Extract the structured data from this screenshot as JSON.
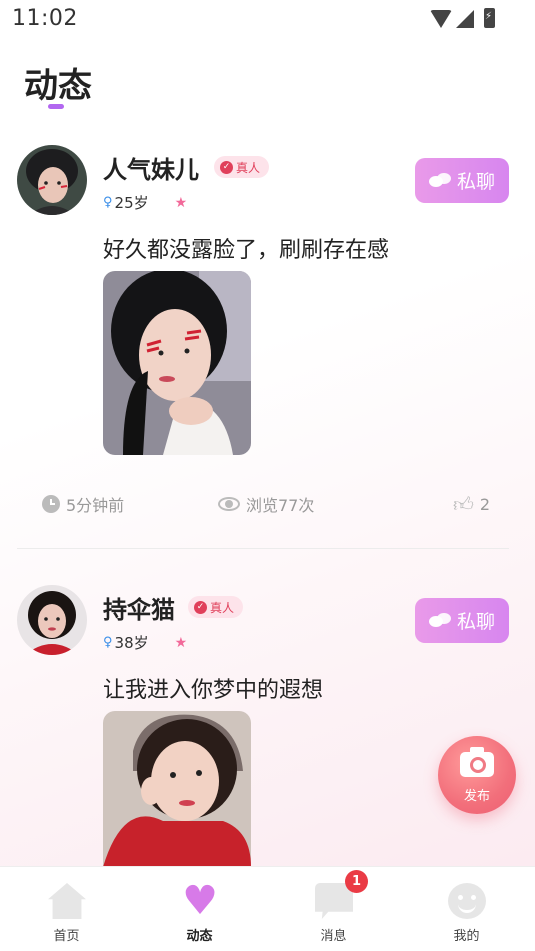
{
  "status_bar": {
    "time": "11:02"
  },
  "page": {
    "title": "动态"
  },
  "posts": [
    {
      "username": "人气妹儿",
      "verified_label": "真人",
      "age": "25岁",
      "chat_label": "私聊",
      "text": "好久都没露脸了，刷刷存在感",
      "time_ago": "5分钟前",
      "views": "浏览77次",
      "likes": "2"
    },
    {
      "username": "持伞猫",
      "verified_label": "真人",
      "age": "38岁",
      "chat_label": "私聊",
      "text": "让我进入你梦中的遐想"
    }
  ],
  "fab": {
    "label": "发布"
  },
  "bottom_nav": {
    "items": [
      {
        "label": "首页",
        "icon": "home-icon"
      },
      {
        "label": "动态",
        "icon": "heart-icon",
        "active": true
      },
      {
        "label": "消息",
        "icon": "message-icon",
        "badge": "1"
      },
      {
        "label": "我的",
        "icon": "smiley-icon"
      }
    ]
  },
  "colors": {
    "accent_purple": "#b267f0",
    "chat_button": "#e099ec",
    "verify_pink": "#e0405b",
    "fab": "#f26f7b",
    "badge_red": "#ea3b45"
  }
}
